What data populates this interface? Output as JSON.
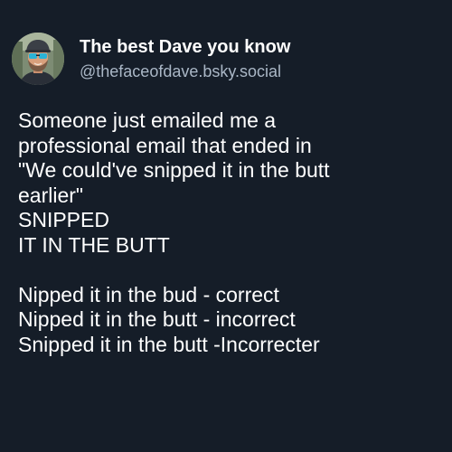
{
  "author": {
    "display_name": "The best Dave you know",
    "handle": "@thefaceofdave.bsky.social",
    "avatar_icon": "profile-photo-man-with-sunglasses-and-cap"
  },
  "post": {
    "lines": [
      "Someone just emailed me a",
      "professional email that ended in",
      "\"We could've snipped it in the butt",
      "earlier\"",
      "SNIPPED",
      "IT IN THE BUTT",
      "Nipped it in the bud - correct",
      "Nipped it in the butt - incorrect",
      "Snipped it in the butt -Incorrecter"
    ]
  },
  "colors": {
    "background": "#151d28",
    "text": "#ffffff",
    "handle": "#aab7c6"
  }
}
